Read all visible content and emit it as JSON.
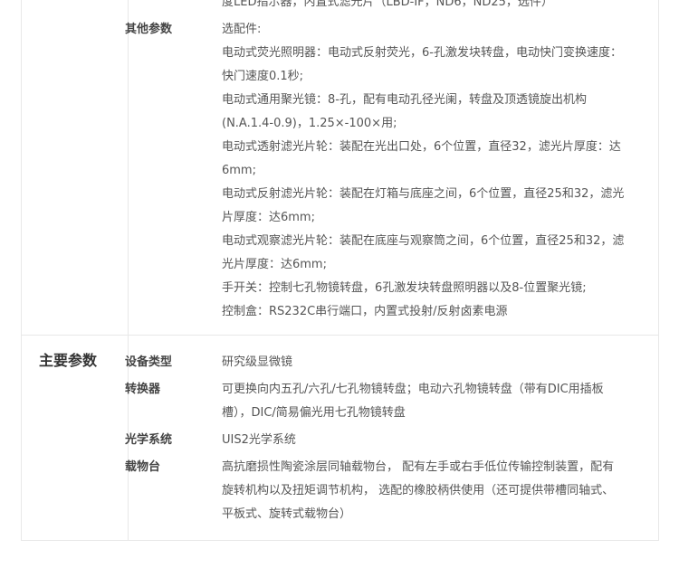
{
  "top_fragment": "度LED指示器，内置式滤光片（LBD-IF，ND6，ND25，选件）",
  "other_params": {
    "label": "其他参数",
    "lines": [
      "选配件:",
      "电动式荧光照明器：电动式反射荧光，6-孔激发块转盘，电动快门变换速度：快门速度0.1秒;",
      "电动式通用聚光镜：8-孔，配有电动孔径光阑，转盘及顶透镜旋出机构(N.A.1.4-0.9)，1.25×-100×用;",
      "电动式透射滤光片轮：装配在光出口处，6个位置，直径32，滤光片厚度：达6mm;",
      "电动式反射滤光片轮：装配在灯箱与底座之间，6个位置，直径25和32，滤光片厚度：达6mm;",
      "电动式观察滤光片轮：装配在底座与观察筒之间，6个位置，直径25和32，滤光片厚度：达6mm;",
      "手开关：控制七孔物镜转盘，6孔激发块转盘照明器以及8-位置聚光镜;",
      "控制盒：RS232C串行端口，内置式投射/反射卤素电源"
    ]
  },
  "main_params": {
    "title": "主要参数",
    "rows": [
      {
        "label": "设备类型",
        "value": "研究级显微镜"
      },
      {
        "label": "转换器",
        "value": "可更换向内五孔/六孔/七孔物镜转盘；电动六孔物镜转盘（带有DIC用插板槽），DIC/简易偏光用七孔物镜转盘"
      },
      {
        "label": "光学系统",
        "value": "UIS2光学系统"
      },
      {
        "label": "载物台",
        "value": "高抗磨损性陶瓷涂层同轴载物台， 配有左手或右手低位传输控制装置，配有旋转机构以及扭矩调节机构， 选配的橡胶柄供使用（还可提供带槽同轴式、平板式、旋转式载物台）"
      }
    ]
  }
}
